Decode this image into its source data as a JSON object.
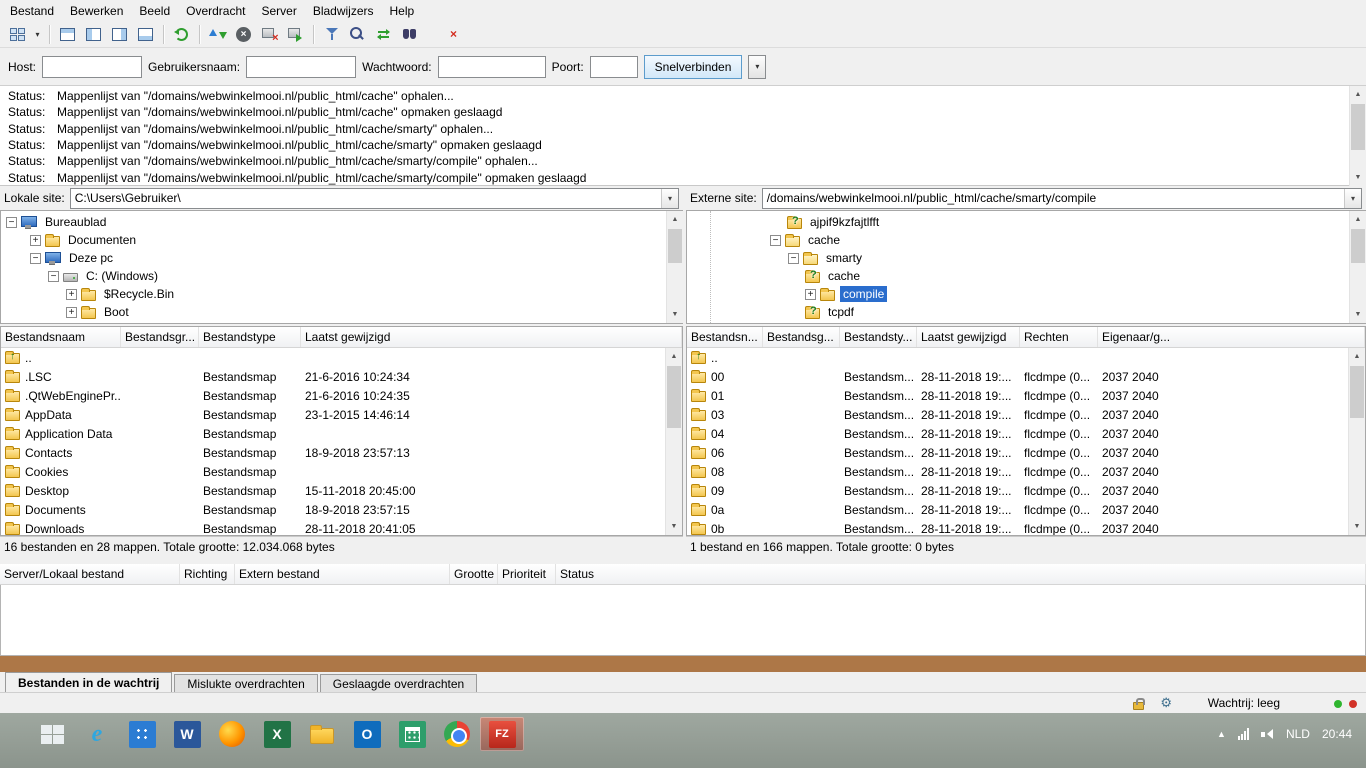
{
  "colors": {
    "selection": "#2a6dcd",
    "band": "#ad7747",
    "taskbar_top": "#9fa8a0",
    "taskbar_bottom": "#8b948c"
  },
  "menu": {
    "items": [
      "Bestand",
      "Bewerken",
      "Beeld",
      "Overdracht",
      "Server",
      "Bladwijzers",
      "Help"
    ]
  },
  "toolbar": {
    "icons": [
      "site-manager",
      "site-manager-dropdown",
      "toggle-log",
      "toggle-local-tree",
      "toggle-remote-tree",
      "toggle-queue",
      "refresh",
      "process-queue",
      "cancel",
      "disconnect",
      "reconnect",
      "filter",
      "compare",
      "sync-browse",
      "find-files",
      "red-x"
    ]
  },
  "quickconnect": {
    "host_label": "Host:",
    "host_value": "",
    "username_label": "Gebruikersnaam:",
    "username_value": "",
    "password_label": "Wachtwoord:",
    "password_value": "",
    "port_label": "Poort:",
    "port_value": "",
    "connect_label": "Snelverbinden"
  },
  "log": {
    "rows": [
      {
        "label": "Status:",
        "text": "Mappenlijst van \"/domains/webwinkelmooi.nl/public_html/cache\" ophalen..."
      },
      {
        "label": "Status:",
        "text": "Mappenlijst van \"/domains/webwinkelmooi.nl/public_html/cache\" opmaken geslaagd"
      },
      {
        "label": "Status:",
        "text": "Mappenlijst van \"/domains/webwinkelmooi.nl/public_html/cache/smarty\" ophalen..."
      },
      {
        "label": "Status:",
        "text": "Mappenlijst van \"/domains/webwinkelmooi.nl/public_html/cache/smarty\" opmaken geslaagd"
      },
      {
        "label": "Status:",
        "text": "Mappenlijst van \"/domains/webwinkelmooi.nl/public_html/cache/smarty/compile\" ophalen..."
      },
      {
        "label": "Status:",
        "text": "Mappenlijst van \"/domains/webwinkelmooi.nl/public_html/cache/smarty/compile\" opmaken geslaagd"
      }
    ]
  },
  "local": {
    "site_label": "Lokale site:",
    "path": "C:\\Users\\Gebruiker\\",
    "tree": [
      {
        "label": "Bureaublad",
        "icon": "desktop",
        "expander": "-",
        "pad": 5
      },
      {
        "label": "Documenten",
        "icon": "folder",
        "expander": "+",
        "pad": 29
      },
      {
        "label": "Deze pc",
        "icon": "computer",
        "expander": "-",
        "pad": 29
      },
      {
        "label": "C: (Windows)",
        "icon": "drive",
        "expander": "-",
        "pad": 47
      },
      {
        "label": "$Recycle.Bin",
        "icon": "folder",
        "expander": "+",
        "pad": 65
      },
      {
        "label": "Boot",
        "icon": "folder",
        "expander": "+",
        "pad": 65
      }
    ],
    "columns": [
      "Bestandsnaam",
      "Bestandsgr...",
      "Bestandstype",
      "Laatst gewijzigd"
    ],
    "files": [
      {
        "name": ".."
      },
      {
        "name": ".LSC",
        "type": "Bestandsmap",
        "date": "21-6-2016 10:24:34"
      },
      {
        "name": ".QtWebEnginePr...",
        "type": "Bestandsmap",
        "date": "21-6-2016 10:24:35"
      },
      {
        "name": "AppData",
        "type": "Bestandsmap",
        "date": "23-1-2015 14:46:14"
      },
      {
        "name": "Application Data",
        "type": "Bestandsmap",
        "date": ""
      },
      {
        "name": "Contacts",
        "type": "Bestandsmap",
        "date": "18-9-2018 23:57:13"
      },
      {
        "name": "Cookies",
        "type": "Bestandsmap",
        "date": ""
      },
      {
        "name": "Desktop",
        "type": "Bestandsmap",
        "date": "15-11-2018 20:45:00"
      },
      {
        "name": "Documents",
        "type": "Bestandsmap",
        "date": "18-9-2018 23:57:15"
      },
      {
        "name": "Downloads",
        "type": "Bestandsmap",
        "date": "28-11-2018 20:41:05"
      }
    ],
    "status": "16 bestanden en 28 mappen. Totale grootte: 12.034.068 bytes"
  },
  "remote": {
    "site_label": "Externe site:",
    "path": "/domains/webwinkelmooi.nl/public_html/cache/smarty/compile",
    "tree": [
      {
        "label": "ajpif9kzfajtlfft",
        "icon": "folder-q",
        "expander": "",
        "pad": 100
      },
      {
        "label": "cache",
        "icon": "folder-open",
        "expander": "-",
        "pad": 83
      },
      {
        "label": "smarty",
        "icon": "folder-open",
        "expander": "-",
        "pad": 101
      },
      {
        "label": "cache",
        "icon": "folder-q",
        "expander": "",
        "pad": 118
      },
      {
        "label": "compile",
        "icon": "folder",
        "expander": "+",
        "pad": 118,
        "selected": true
      },
      {
        "label": "tcpdf",
        "icon": "folder-q",
        "expander": "",
        "pad": 118
      }
    ],
    "columns": [
      "Bestandsn...",
      "Bestandsg...",
      "Bestandsty...",
      "Laatst gewijzigd",
      "Rechten",
      "Eigenaar/g..."
    ],
    "files": [
      {
        "name": ".."
      },
      {
        "name": "00",
        "type": "Bestandsm...",
        "date": "28-11-2018 19:...",
        "perms": "flcdmpe (0...",
        "owner": "2037 2040"
      },
      {
        "name": "01",
        "type": "Bestandsm...",
        "date": "28-11-2018 19:...",
        "perms": "flcdmpe (0...",
        "owner": "2037 2040"
      },
      {
        "name": "03",
        "type": "Bestandsm...",
        "date": "28-11-2018 19:...",
        "perms": "flcdmpe (0...",
        "owner": "2037 2040"
      },
      {
        "name": "04",
        "type": "Bestandsm...",
        "date": "28-11-2018 19:...",
        "perms": "flcdmpe (0...",
        "owner": "2037 2040"
      },
      {
        "name": "06",
        "type": "Bestandsm...",
        "date": "28-11-2018 19:...",
        "perms": "flcdmpe (0...",
        "owner": "2037 2040"
      },
      {
        "name": "08",
        "type": "Bestandsm...",
        "date": "28-11-2018 19:...",
        "perms": "flcdmpe (0...",
        "owner": "2037 2040"
      },
      {
        "name": "09",
        "type": "Bestandsm...",
        "date": "28-11-2018 19:...",
        "perms": "flcdmpe (0...",
        "owner": "2037 2040"
      },
      {
        "name": "0a",
        "type": "Bestandsm...",
        "date": "28-11-2018 19:...",
        "perms": "flcdmpe (0...",
        "owner": "2037 2040"
      },
      {
        "name": "0b",
        "type": "Bestandsm...",
        "date": "28-11-2018 19:...",
        "perms": "flcdmpe (0...",
        "owner": "2037 2040"
      }
    ],
    "status": "1 bestand en 166 mappen. Totale grootte: 0 bytes"
  },
  "queue": {
    "columns": [
      "Server/Lokaal bestand",
      "Richting",
      "Extern bestand",
      "Grootte",
      "Prioriteit",
      "Status"
    ],
    "tabs": [
      "Bestanden in de wachtrij",
      "Mislukte overdrachten",
      "Geslaagde overdrachten"
    ]
  },
  "statusbar": {
    "queue_text": "Wachtrij: leeg"
  },
  "taskbar": {
    "apps": [
      "start",
      "internet-explorer",
      "remote-app",
      "word",
      "firefox",
      "excel",
      "file-explorer",
      "outlook",
      "calculator",
      "chrome",
      "filezilla"
    ],
    "active_app": "filezilla",
    "tray": {
      "language": "NLD",
      "time": "20:44"
    }
  }
}
